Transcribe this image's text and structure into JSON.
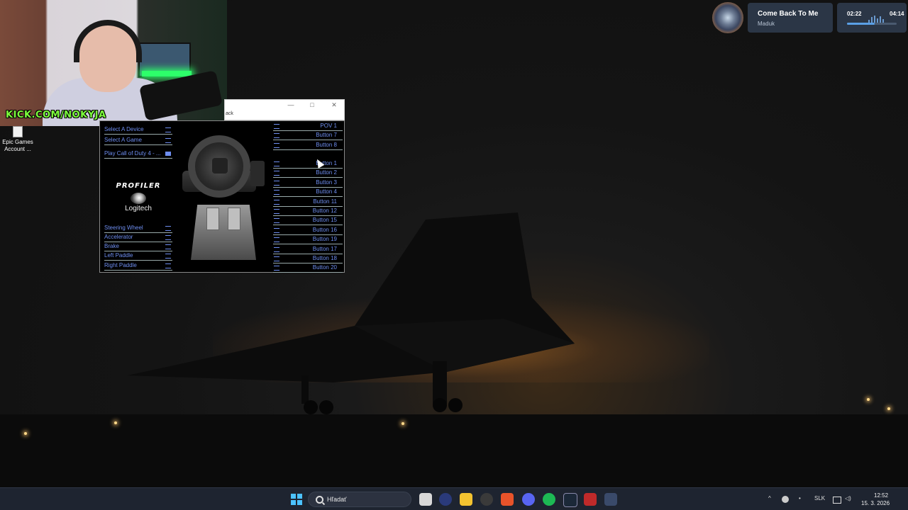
{
  "webcam": {
    "url_overlay": "KICK.COM/NOKYJA"
  },
  "desktop": {
    "icons": [
      {
        "label_line1": "Epic Games",
        "label_line2": "Account ..."
      }
    ]
  },
  "now_playing": {
    "title": "Come Back To Me",
    "artist": "Maduk",
    "elapsed": "02:22",
    "total": "04:14",
    "progress": 0.56
  },
  "window": {
    "titlebar": {
      "minimize": "—",
      "maximize": "□",
      "close": "✕"
    },
    "toolbar_text": "ack"
  },
  "profiler": {
    "menu": [
      {
        "label": "Select A Device"
      },
      {
        "label": "Select A Game"
      },
      {
        "label": "Play Call of Duty 4 - ..."
      }
    ],
    "logo": {
      "product": "PROFILER",
      "brand": "Logitech"
    },
    "axes": [
      {
        "label": "Steering Wheel"
      },
      {
        "label": "Accelerator"
      },
      {
        "label": "Brake"
      },
      {
        "label": "Left Paddle"
      },
      {
        "label": "Right Paddle"
      }
    ],
    "bindings_top": [
      "POV 1",
      "Button 7",
      "Button 8"
    ],
    "bindings_main": [
      "Button 1",
      "Button 2",
      "Button 3",
      "Button 4",
      "Button 11",
      "Button 12",
      "Button 15",
      "Button 16",
      "Button 19",
      "Button 17",
      "Button 18",
      "Button 20"
    ]
  },
  "taskbar": {
    "search_placeholder": "Hľadať",
    "apps": [
      "file-explorer",
      "app-2",
      "folder",
      "chrome",
      "brave",
      "discord",
      "spotify",
      "steam",
      "app-9",
      "app-10"
    ],
    "tray": {
      "language": "SLK",
      "time": "12:52",
      "date": "15. 3. 2026"
    }
  },
  "colors": {
    "accent_blue": "#6e8ef0",
    "taskbar_bg": "#1e2430",
    "kick_green": "#7cff3c"
  }
}
